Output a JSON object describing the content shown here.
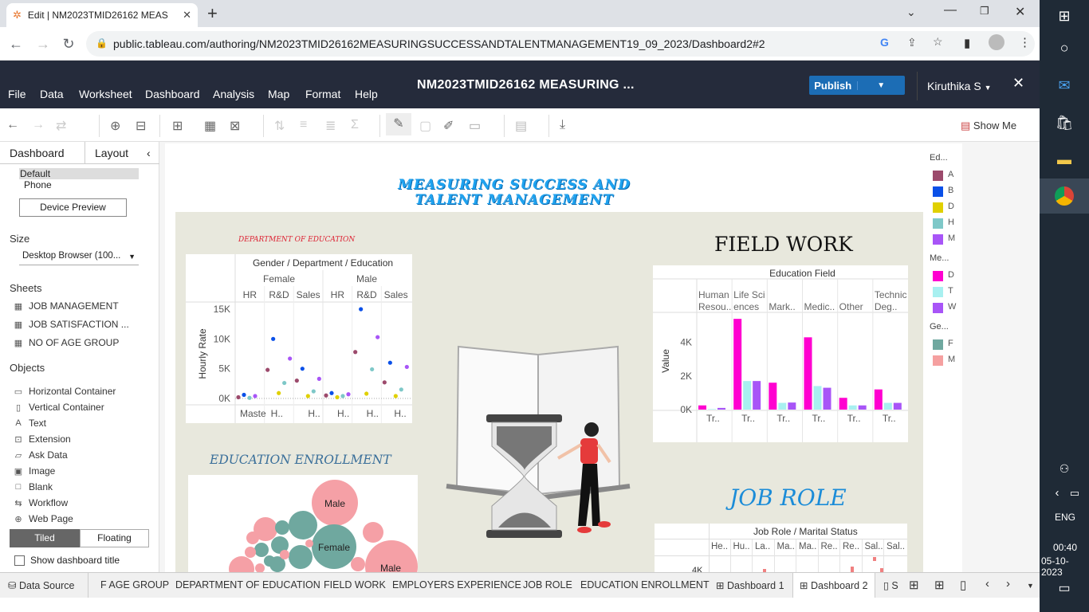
{
  "browser": {
    "tab_title": "Edit | NM2023TMID26162 MEAS",
    "new_tab": "+",
    "url": "public.tableau.com/authoring/NM2023TMID26162MEASURINGSUCCESSANDTALENTMANAGEMENT19_09_2023/Dashboard2#2"
  },
  "menubar": {
    "items": [
      "File",
      "Data",
      "Worksheet",
      "Dashboard",
      "Analysis",
      "Map",
      "Format",
      "Help"
    ],
    "workbook_title": "NM2023TMID26162 MEASURING ...",
    "publish_label": "Publish",
    "user": "Kiruthika S"
  },
  "toolbar": {
    "show_me": "Show Me"
  },
  "left_pane": {
    "tab_dashboard": "Dashboard",
    "tab_layout": "Layout",
    "device_default": "Default",
    "device_phone": "Phone",
    "device_preview": "Device Preview",
    "size_title": "Size",
    "size_value": "Desktop Browser (100...",
    "sheets_title": "Sheets",
    "sheets": [
      "JOB MANAGEMENT",
      "JOB SATISFACTION ...",
      "NO OF AGE GROUP"
    ],
    "objects_title": "Objects",
    "objects": [
      "Horizontal Container",
      "Vertical Container",
      "Text",
      "Extension",
      "Ask Data",
      "Image",
      "Blank",
      "Workflow",
      "Web Page"
    ],
    "tiled": "Tiled",
    "floating": "Floating",
    "show_title": "Show dashboard title"
  },
  "dashboard": {
    "title_line1": "MEASURING SUCCESS AND",
    "title_line2": "TALENT MANAGEMENT",
    "dept_edu_title": "DEPARTMENT OF EDUCATION",
    "field_work_title": "FIELD WORK",
    "edu_enroll_title": "EDUCATION ENROLLMENT",
    "job_role_title": "JOB ROLE"
  },
  "legend": {
    "groups": [
      {
        "title": "Ed...",
        "items": [
          {
            "label": "A",
            "color": "#9c4a6c"
          },
          {
            "label": "B",
            "color": "#0a50e8"
          },
          {
            "label": "D",
            "color": "#e0d000"
          },
          {
            "label": "H",
            "color": "#7ec8c8"
          },
          {
            "label": "M",
            "color": "#a855f7"
          }
        ]
      },
      {
        "title": "Me...",
        "items": [
          {
            "label": "D",
            "color": "#ff00d0"
          },
          {
            "label": "T",
            "color": "#a8f0f0"
          },
          {
            "label": "W",
            "color": "#a855f7"
          }
        ]
      },
      {
        "title": "Ge...",
        "items": [
          {
            "label": "F",
            "color": "#6fa89f"
          },
          {
            "label": "M",
            "color": "#f5a0a0"
          }
        ]
      }
    ]
  },
  "chart_data": [
    {
      "type": "scatter",
      "title": "Gender / Department / Education",
      "ylabel": "Hourly Rate",
      "ylim": [
        0,
        15000
      ],
      "yticks": [
        "15K",
        "10K",
        "5K",
        "0K"
      ],
      "gender_headers": [
        "Female",
        "Male"
      ],
      "department_headers": [
        "HR",
        "R&D",
        "Sales",
        "HR",
        "R&D",
        "Sales"
      ],
      "bottom_labels": [
        "Maste",
        "H..",
        "H..",
        "H..",
        "H..",
        "H.."
      ],
      "points": [
        {
          "dept": 0,
          "value": 200,
          "color": "#9c4a6c"
        },
        {
          "dept": 0,
          "value": 600,
          "color": "#0a50e8"
        },
        {
          "dept": 0,
          "value": 100,
          "color": "#7ec8c8"
        },
        {
          "dept": 0,
          "value": 400,
          "color": "#a855f7"
        },
        {
          "dept": 1,
          "value": 4800,
          "color": "#9c4a6c"
        },
        {
          "dept": 1,
          "value": 10000,
          "color": "#0a50e8"
        },
        {
          "dept": 1,
          "value": 900,
          "color": "#e0d000"
        },
        {
          "dept": 1,
          "value": 2600,
          "color": "#7ec8c8"
        },
        {
          "dept": 1,
          "value": 6700,
          "color": "#a855f7"
        },
        {
          "dept": 2,
          "value": 3000,
          "color": "#9c4a6c"
        },
        {
          "dept": 2,
          "value": 5000,
          "color": "#0a50e8"
        },
        {
          "dept": 2,
          "value": 400,
          "color": "#e0d000"
        },
        {
          "dept": 2,
          "value": 1200,
          "color": "#7ec8c8"
        },
        {
          "dept": 2,
          "value": 3300,
          "color": "#a855f7"
        },
        {
          "dept": 3,
          "value": 500,
          "color": "#9c4a6c"
        },
        {
          "dept": 3,
          "value": 900,
          "color": "#0a50e8"
        },
        {
          "dept": 3,
          "value": 200,
          "color": "#e0d000"
        },
        {
          "dept": 3,
          "value": 400,
          "color": "#7ec8c8"
        },
        {
          "dept": 3,
          "value": 700,
          "color": "#a855f7"
        },
        {
          "dept": 4,
          "value": 7800,
          "color": "#9c4a6c"
        },
        {
          "dept": 4,
          "value": 15000,
          "color": "#0a50e8"
        },
        {
          "dept": 4,
          "value": 800,
          "color": "#e0d000"
        },
        {
          "dept": 4,
          "value": 4900,
          "color": "#7ec8c8"
        },
        {
          "dept": 4,
          "value": 10300,
          "color": "#a855f7"
        },
        {
          "dept": 5,
          "value": 2700,
          "color": "#9c4a6c"
        },
        {
          "dept": 5,
          "value": 6000,
          "color": "#0a50e8"
        },
        {
          "dept": 5,
          "value": 400,
          "color": "#e0d000"
        },
        {
          "dept": 5,
          "value": 1500,
          "color": "#7ec8c8"
        },
        {
          "dept": 5,
          "value": 5300,
          "color": "#a855f7"
        }
      ]
    },
    {
      "type": "bar",
      "title": "Education Field",
      "ylabel": "Value",
      "ylim": [
        0,
        5500
      ],
      "yticks": [
        "4K",
        "2K",
        "0K"
      ],
      "categories": [
        "Human Resou..",
        "Life Sci ences",
        "Mark..",
        "Medic..",
        "Other",
        "Technic al Deg.."
      ],
      "bottom_labels": [
        "Tr..",
        "Tr..",
        "Tr..",
        "Tr..",
        "Tr..",
        "Tr.."
      ],
      "series": [
        {
          "color": "#ff00d0",
          "values": [
            250,
            5400,
            1600,
            4300,
            700,
            1200
          ]
        },
        {
          "color": "#a8f0f0",
          "values": [
            30,
            1700,
            400,
            1400,
            250,
            400
          ]
        },
        {
          "color": "#a855f7",
          "values": [
            100,
            1700,
            420,
            1300,
            250,
            400
          ]
        }
      ]
    },
    {
      "type": "bubble",
      "labels": [
        "Male",
        "Female",
        "Male"
      ]
    },
    {
      "type": "bar",
      "title": "Job Role / Marital Status",
      "yticks": [
        "4K"
      ],
      "categories": [
        "He..",
        "Hu..",
        "La..",
        "Ma..",
        "Ma..",
        "Re..",
        "Re..",
        "Sal..",
        "Sal.."
      ]
    }
  ],
  "sheet_tabs": {
    "data_source": "Data Source",
    "tabs": [
      "F AGE GROUP",
      "DEPARTMENT OF EDUCATION",
      "FIELD WORK",
      "EMPLOYERS EXPERIENCE",
      "JOB ROLE",
      "EDUCATION ENROLLMENT",
      "Dashboard 1",
      "Dashboard 2"
    ]
  },
  "taskbar": {
    "lang": "ENG",
    "time": "00:40",
    "date": "05-10-2023"
  }
}
